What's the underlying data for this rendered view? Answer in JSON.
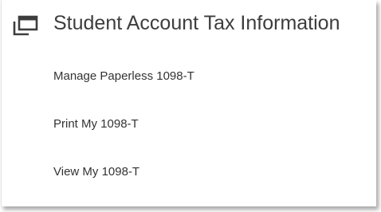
{
  "panel": {
    "title": "Student Account Tax Information",
    "icon": "window-stack-icon"
  },
  "links": [
    {
      "label": "Manage Paperless 1098-T"
    },
    {
      "label": "Print My 1098-T"
    },
    {
      "label": "View My 1098-T"
    }
  ],
  "colors": {
    "title_text": "#3d3d3d",
    "link_text": "#333333",
    "icon": "#3d3d3d",
    "background": "#ffffff"
  }
}
